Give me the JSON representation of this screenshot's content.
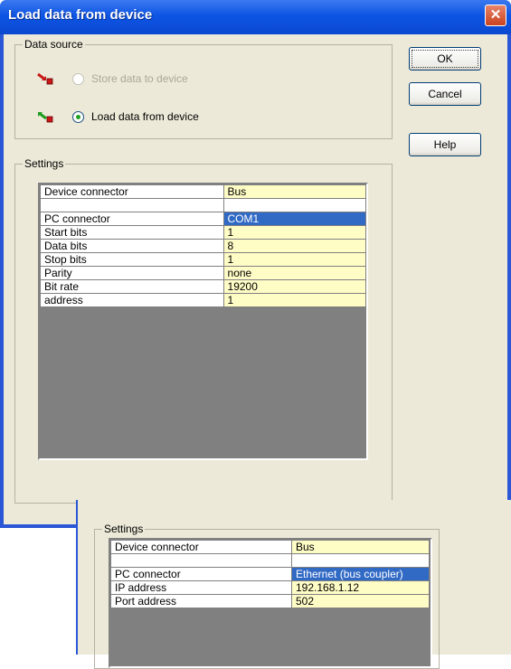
{
  "window": {
    "title": "Load data from device"
  },
  "buttons": {
    "ok": "OK",
    "cancel": "Cancel",
    "help": "Help"
  },
  "data_source": {
    "legend": "Data source",
    "store_label": "Store data to device",
    "load_label": "Load data from device",
    "selected": "load"
  },
  "settings": {
    "legend": "Settings",
    "rows": [
      {
        "key": "Device connector",
        "value": "Bus"
      },
      {
        "key": "",
        "value": ""
      },
      {
        "key": "PC connector",
        "value": "COM1"
      },
      {
        "key": "Start bits",
        "value": "1"
      },
      {
        "key": "Data bits",
        "value": "8"
      },
      {
        "key": "Stop bits",
        "value": "1"
      },
      {
        "key": "Parity",
        "value": "none"
      },
      {
        "key": "Bit rate",
        "value": "19200"
      },
      {
        "key": "address",
        "value": "1"
      }
    ]
  },
  "settings2": {
    "legend": "Settings",
    "rows": [
      {
        "key": "Device connector",
        "value": "Bus"
      },
      {
        "key": "",
        "value": ""
      },
      {
        "key": "PC connector",
        "value": "Ethernet (bus coupler)"
      },
      {
        "key": "IP address",
        "value": "192.168.1.12"
      },
      {
        "key": "Port address",
        "value": "502"
      }
    ]
  },
  "colors": {
    "title_bar": "#0d55e4",
    "selection": "#316ac5",
    "value_cell": "#fffdc6",
    "grid_bg": "#808080"
  },
  "icons": {
    "store": "device-write-icon",
    "load": "device-read-icon",
    "close": "close-icon"
  }
}
